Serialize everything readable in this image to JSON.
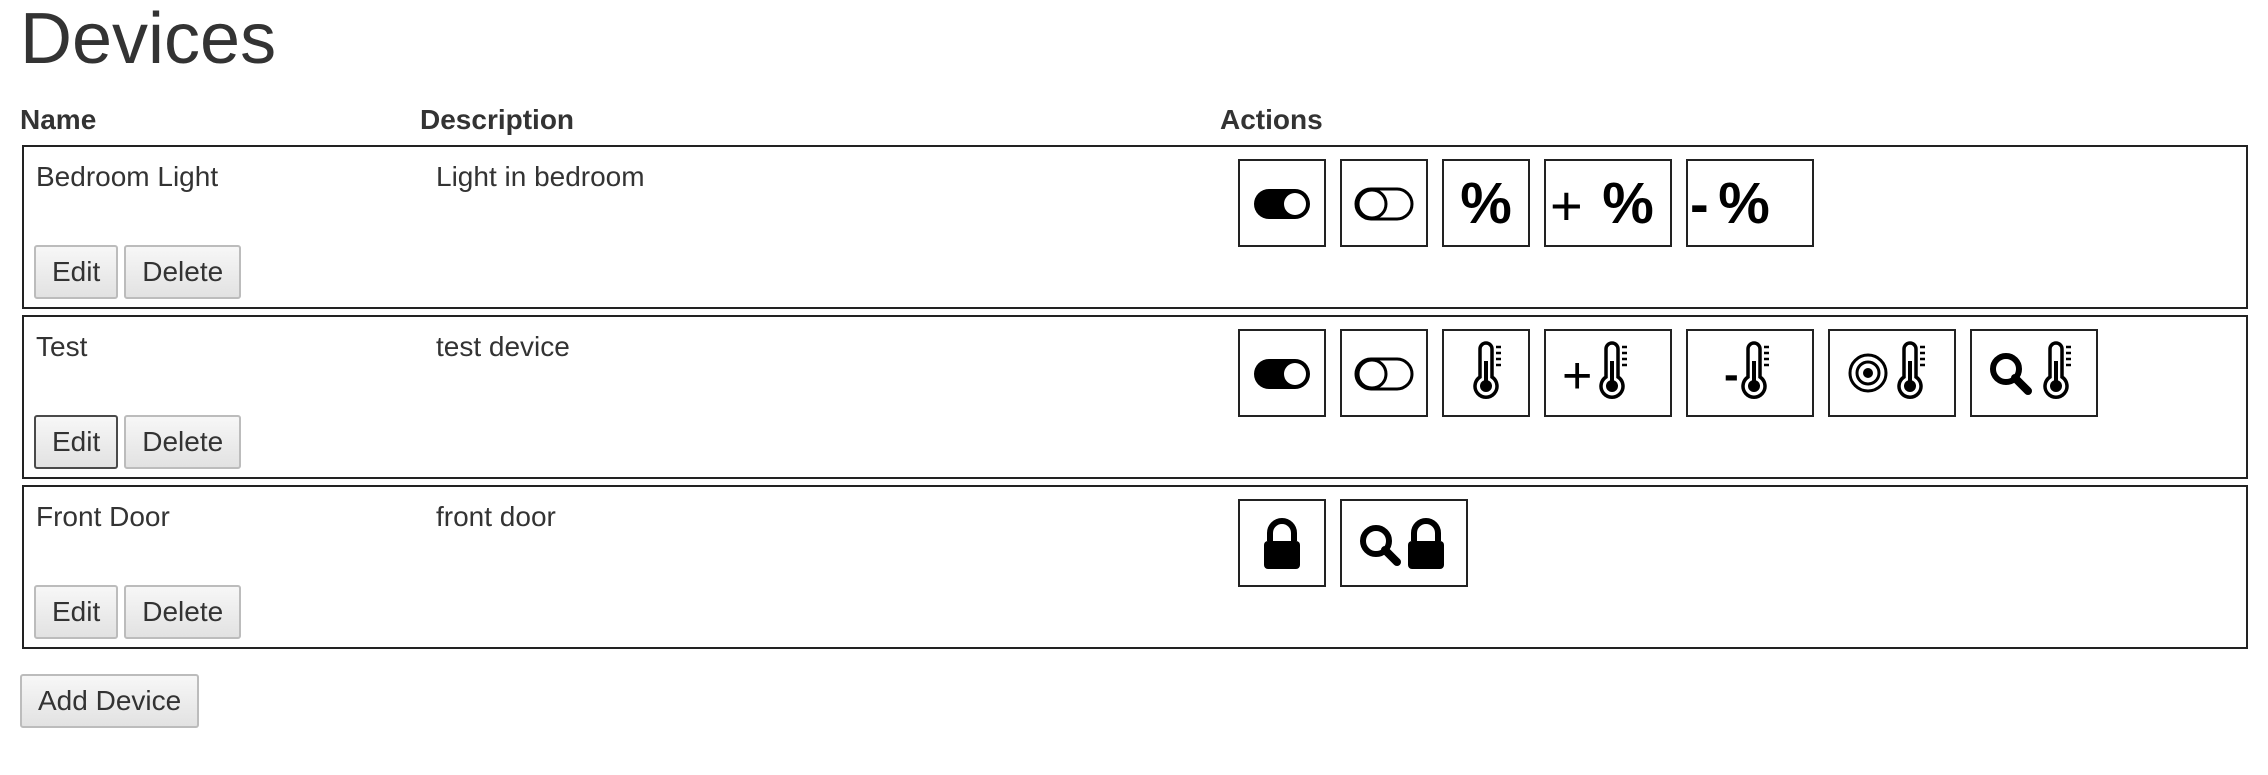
{
  "page": {
    "title": "Devices"
  },
  "table": {
    "headers": {
      "name": "Name",
      "description": "Description",
      "actions": "Actions"
    }
  },
  "devices": [
    {
      "name": "Bedroom Light",
      "description": "Light in bedroom",
      "edit_label": "Edit",
      "delete_label": "Delete",
      "action_icons": [
        "toggle-on-icon",
        "toggle-off-icon",
        "percent-icon",
        "percent-plus-icon",
        "percent-minus-icon"
      ]
    },
    {
      "name": "Test",
      "description": "test device",
      "edit_label": "Edit",
      "delete_label": "Delete",
      "action_icons": [
        "toggle-on-icon",
        "toggle-off-icon",
        "thermometer-icon",
        "thermometer-plus-icon",
        "thermometer-minus-icon",
        "thermometer-target-icon",
        "thermometer-search-icon"
      ]
    },
    {
      "name": "Front Door",
      "description": "front door",
      "edit_label": "Edit",
      "delete_label": "Delete",
      "action_icons": [
        "lock-icon",
        "lock-search-icon"
      ]
    }
  ],
  "add_device_label": "Add Device",
  "icon_text": {
    "percent": "%",
    "plus": "+",
    "minus": "-"
  }
}
